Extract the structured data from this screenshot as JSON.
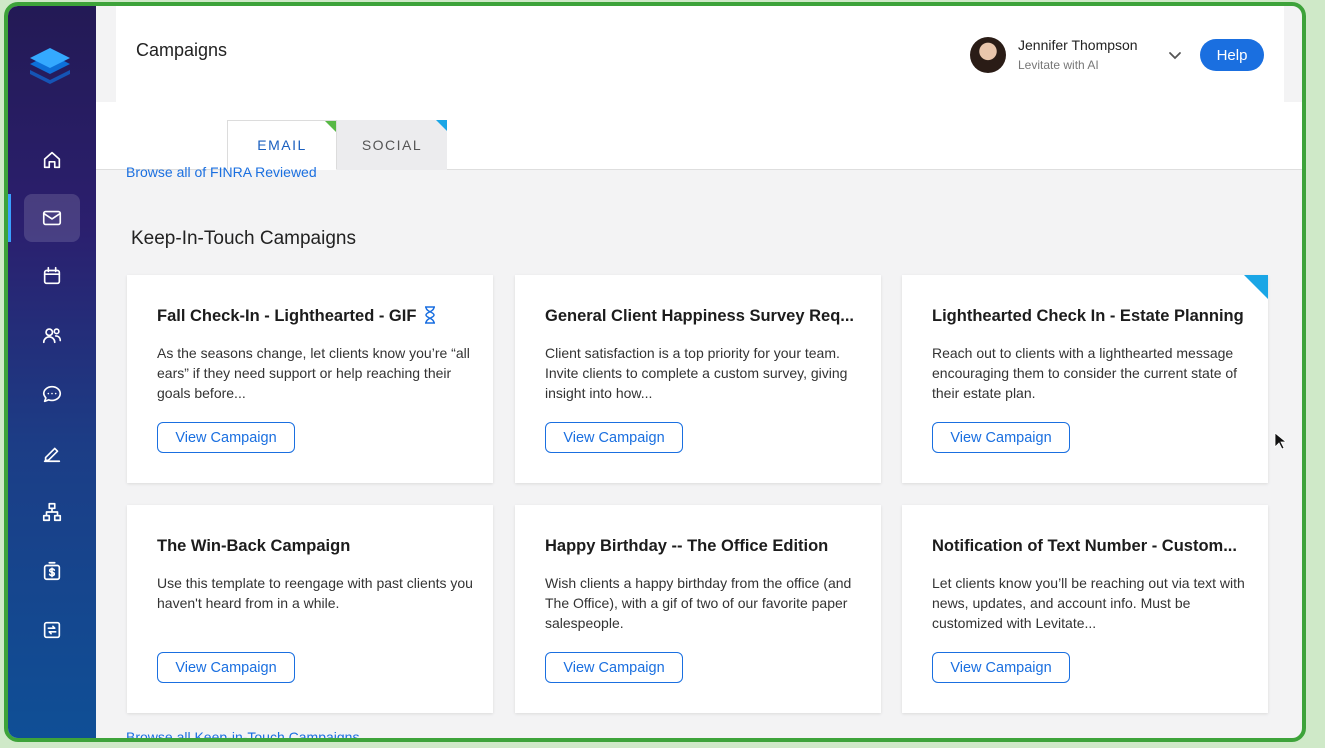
{
  "header": {
    "page_title": "Campaigns",
    "user_name": "Jennifer Thompson",
    "user_subtitle": "Levitate with AI",
    "help_label": "Help"
  },
  "tabs": [
    {
      "label": "EMAIL",
      "active": true
    },
    {
      "label": "SOCIAL",
      "active": false
    }
  ],
  "links": {
    "browse_finra": "Browse all of FINRA Reviewed",
    "browse_kit": "Browse all Keep-in-Touch Campaigns"
  },
  "section": {
    "title": "Keep-In-Touch Campaigns"
  },
  "cards": [
    {
      "title": "Fall Check-In - Lighthearted - GIF",
      "desc": "As the seasons change, let clients know you’re “all ears” if they need support or help reaching their goals before...",
      "button": "View Campaign"
    },
    {
      "title": "General Client Happiness Survey Req...",
      "desc": "Client satisfaction is a top priority for your team. Invite clients to complete a custom survey, giving insight into how...",
      "button": "View Campaign"
    },
    {
      "title": "Lighthearted Check In - Estate Planning",
      "desc": "Reach out to clients with a lighthearted message encouraging them to consider the current state of their estate plan.",
      "button": "View Campaign"
    },
    {
      "title": "The Win-Back Campaign",
      "desc": "Use this template to reengage with past clients you haven't heard from in a while.",
      "button": "View Campaign"
    },
    {
      "title": "Happy Birthday -- The Office Edition",
      "desc": "Wish clients a happy birthday from the office (and The Office), with a gif of two of our favorite paper salespeople.",
      "button": "View Campaign"
    },
    {
      "title": "Notification of Text Number - Custom...",
      "desc": "Let clients know you’ll be reaching out via text with news, updates, and account info. Must be customized with Levitate...",
      "button": "View Campaign"
    }
  ],
  "nav": [
    "home-icon",
    "mail-icon",
    "calendar-icon",
    "contacts-icon",
    "chat-icon",
    "pen-icon",
    "org-chart-icon",
    "money-icon",
    "transfer-icon"
  ],
  "colors": {
    "accent": "#1a6fe0",
    "frame": "#3da33a"
  }
}
